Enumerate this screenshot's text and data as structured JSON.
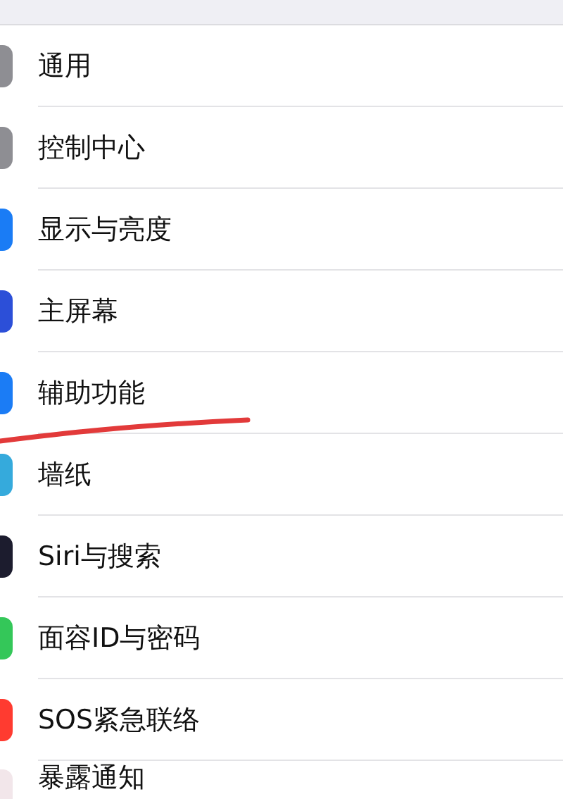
{
  "settings_items": [
    {
      "label": "通用",
      "color": "#8e8e93",
      "annotated": false
    },
    {
      "label": "控制中心",
      "color": "#8e8e93",
      "annotated": false
    },
    {
      "label": "显示与亮度",
      "color": "#1a7cf5",
      "annotated": false
    },
    {
      "label": "主屏幕",
      "color": "#2c4fd8",
      "annotated": false
    },
    {
      "label": "辅助功能",
      "color": "#1b7cf5",
      "annotated": true
    },
    {
      "label": "墙纸",
      "color": "#35aadc",
      "annotated": false
    },
    {
      "label": "Siri与搜索",
      "color": "#1c1c2e",
      "annotated": false
    },
    {
      "label": "面容ID与密码",
      "color": "#34c759",
      "annotated": false
    },
    {
      "label": "SOS紧急联络",
      "color": "#ff3b30",
      "annotated": false
    },
    {
      "label": "暴露通知",
      "color": "#f2e6ea",
      "annotated": false
    }
  ]
}
